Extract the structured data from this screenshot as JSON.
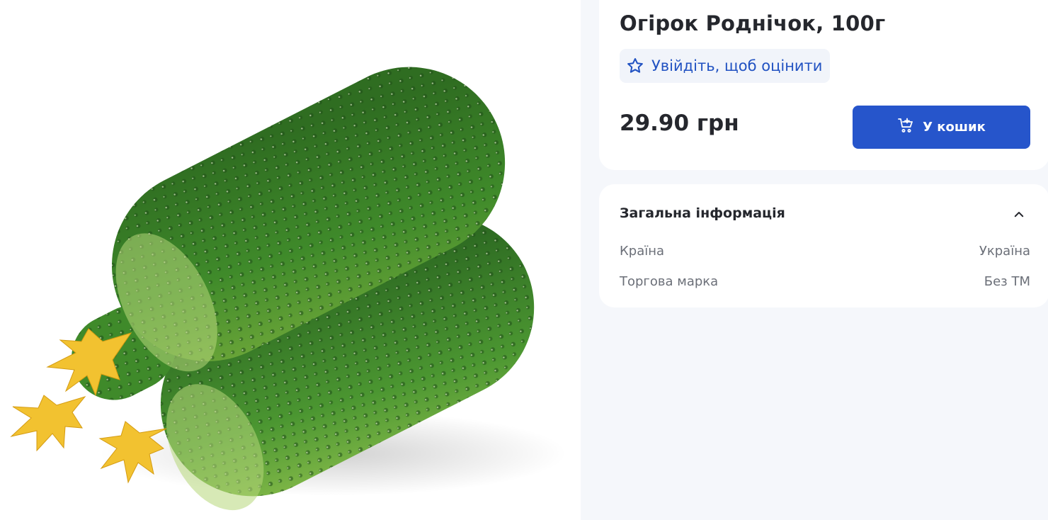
{
  "product": {
    "image_alt": "cucumber-photo",
    "title": "Огірок Роднічок, 100г",
    "rating_label": "Увійдіть, щоб оцінити",
    "price": "29.90 грн",
    "cart_label": "У кошик"
  },
  "info": {
    "header": "Загальна інформація",
    "rows": [
      {
        "label": "Країна",
        "value": "Україна"
      },
      {
        "label": "Торгова марка",
        "value": "Без ТМ"
      }
    ]
  },
  "colors": {
    "accent": "#2655cb",
    "rating_text": "#2152c2",
    "page_bg": "#f5f7fb"
  },
  "icons": [
    "star-outline-icon",
    "cart-plus-icon",
    "chevron-up-icon"
  ]
}
